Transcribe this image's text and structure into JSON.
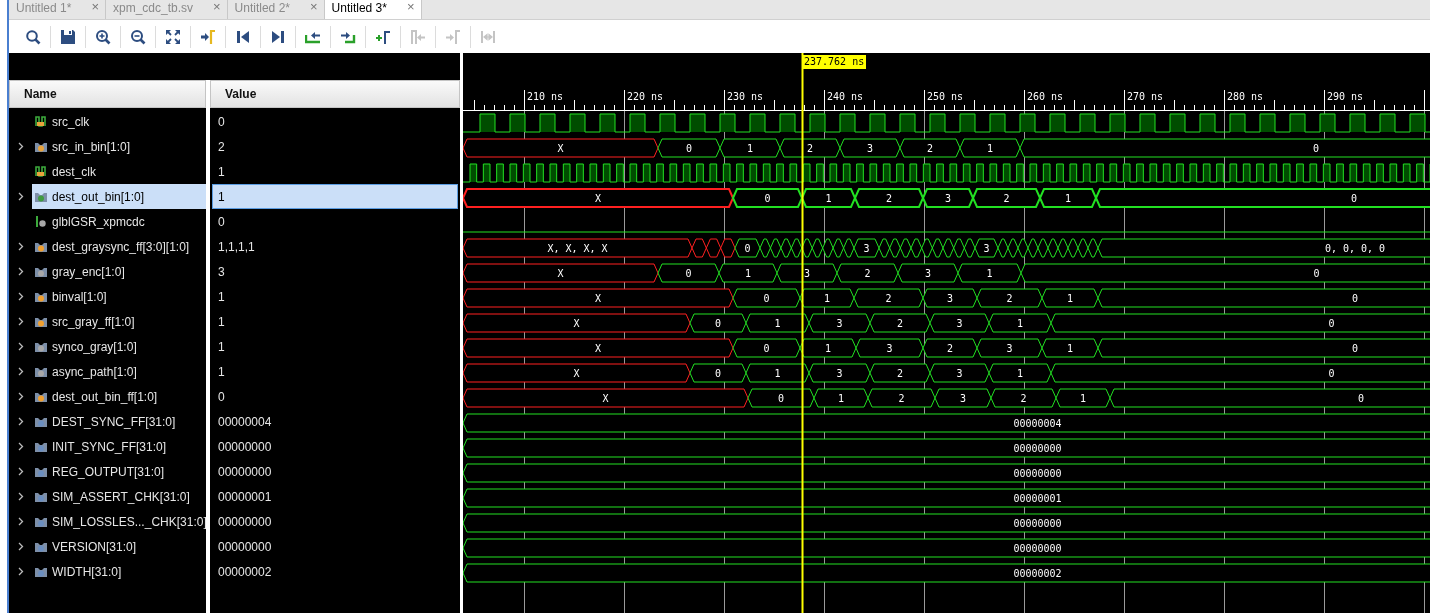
{
  "tabs": [
    {
      "label": "Untitled 1*",
      "close": "×",
      "selected": false
    },
    {
      "label": "xpm_cdc_tb.sv",
      "close": "×",
      "selected": false
    },
    {
      "label": "Untitled 2*",
      "close": "×",
      "selected": false
    },
    {
      "label": "Untitled 3*",
      "close": "×",
      "selected": true
    }
  ],
  "toolbar": [
    {
      "kind": "search",
      "disabled": false
    },
    {
      "kind": "save",
      "disabled": false
    },
    {
      "kind": "zoom_in",
      "disabled": false
    },
    {
      "kind": "zoom_out",
      "disabled": false
    },
    {
      "kind": "zoom_fit",
      "disabled": false
    },
    {
      "kind": "go_to_cursor",
      "disabled": false
    },
    {
      "kind": "go_to_start",
      "disabled": false
    },
    {
      "kind": "go_to_end",
      "disabled": false
    },
    {
      "kind": "previous_transition",
      "disabled": false
    },
    {
      "kind": "next_transition",
      "disabled": false
    },
    {
      "kind": "add_marker",
      "disabled": false
    },
    {
      "kind": "previous_marker",
      "disabled": true
    },
    {
      "kind": "next_marker",
      "disabled": true
    },
    {
      "kind": "swap_markers",
      "disabled": true
    }
  ],
  "columns": [
    "Name",
    "Value"
  ],
  "cursor": {
    "time": "237.762 ns"
  },
  "ruler": [
    "210 ns",
    "220 ns",
    "230 ns",
    "240 ns",
    "250 ns",
    "260 ns",
    "270 ns",
    "280 ns",
    "290 ns"
  ],
  "signals": [
    {
      "name": "src_clk",
      "value": "0",
      "kind": "clock",
      "expandable": false,
      "selected": false,
      "color": "#e8a33c"
    },
    {
      "name": "src_in_bin[1:0]",
      "value": "2",
      "kind": "bus",
      "expandable": true,
      "selected": false,
      "color": "#e8a33c",
      "wave_values": [
        {
          "value": "X",
          "unknown": true
        },
        {
          "value": "0",
          "unknown": false
        },
        {
          "value": "1",
          "unknown": false
        },
        {
          "value": "2",
          "unknown": false
        },
        {
          "value": "3",
          "unknown": false
        },
        {
          "value": "2",
          "unknown": false
        },
        {
          "value": "1",
          "unknown": false
        },
        {
          "value": "0",
          "unknown": false
        }
      ]
    },
    {
      "name": "dest_clk",
      "value": "1",
      "kind": "clock",
      "expandable": false,
      "selected": false,
      "color": "#e8a33c"
    },
    {
      "name": "dest_out_bin[1:0]",
      "value": "1",
      "kind": "bus",
      "expandable": true,
      "selected": true,
      "color": "#3f9b3f",
      "wave_values": [
        {
          "value": "X",
          "unknown": true
        },
        {
          "value": "0",
          "unknown": false
        },
        {
          "value": "1",
          "unknown": false
        },
        {
          "value": "2",
          "unknown": false
        },
        {
          "value": "3",
          "unknown": false
        },
        {
          "value": "2",
          "unknown": false
        },
        {
          "value": "1",
          "unknown": false
        },
        {
          "value": "0",
          "unknown": false
        }
      ]
    },
    {
      "name": "glblGSR_xpmcdc",
      "value": "0",
      "kind": "bit",
      "expandable": false,
      "selected": false,
      "color": "#a8a8a8"
    },
    {
      "name": "dest_graysync_ff[3:0][1:0]",
      "value": "1,1,1,1",
      "kind": "bus",
      "expandable": true,
      "selected": false,
      "color": "#f0a030",
      "wave_values": [
        {
          "value": "X, X, X, X",
          "unknown": true
        },
        {
          "value": "0",
          "unknown": false
        },
        {
          "value": "3",
          "unknown": false
        },
        {
          "value": "3",
          "unknown": false
        },
        {
          "value": "0, 0, 0, 0",
          "unknown": false
        }
      ]
    },
    {
      "name": "gray_enc[1:0]",
      "value": "3",
      "kind": "bus",
      "expandable": true,
      "selected": false,
      "color": "#a8a8a8",
      "wave_values": [
        {
          "value": "X",
          "unknown": true
        },
        {
          "value": "0",
          "unknown": false
        },
        {
          "value": "1",
          "unknown": false
        },
        {
          "value": "3",
          "unknown": false
        },
        {
          "value": "2",
          "unknown": false
        },
        {
          "value": "3",
          "unknown": false
        },
        {
          "value": "1",
          "unknown": false
        },
        {
          "value": "0",
          "unknown": false
        }
      ]
    },
    {
      "name": "binval[1:0]",
      "value": "1",
      "kind": "bus",
      "expandable": true,
      "selected": false,
      "color": "#f0a030",
      "wave_values": [
        {
          "value": "X",
          "unknown": true
        },
        {
          "value": "0",
          "unknown": false
        },
        {
          "value": "1",
          "unknown": false
        },
        {
          "value": "2",
          "unknown": false
        },
        {
          "value": "3",
          "unknown": false
        },
        {
          "value": "2",
          "unknown": false
        },
        {
          "value": "1",
          "unknown": false
        },
        {
          "value": "0",
          "unknown": false
        }
      ]
    },
    {
      "name": "src_gray_ff[1:0]",
      "value": "1",
      "kind": "bus",
      "expandable": true,
      "selected": false,
      "color": "#f0a030",
      "wave_values": [
        {
          "value": "X",
          "unknown": true
        },
        {
          "value": "0",
          "unknown": false
        },
        {
          "value": "1",
          "unknown": false
        },
        {
          "value": "3",
          "unknown": false
        },
        {
          "value": "2",
          "unknown": false
        },
        {
          "value": "3",
          "unknown": false
        },
        {
          "value": "1",
          "unknown": false
        },
        {
          "value": "0",
          "unknown": false
        }
      ]
    },
    {
      "name": "synco_gray[1:0]",
      "value": "1",
      "kind": "bus",
      "expandable": true,
      "selected": false,
      "color": "#a8a8a8",
      "wave_values": [
        {
          "value": "X",
          "unknown": true
        },
        {
          "value": "0",
          "unknown": false
        },
        {
          "value": "1",
          "unknown": false
        },
        {
          "value": "3",
          "unknown": false
        },
        {
          "value": "2",
          "unknown": false
        },
        {
          "value": "3",
          "unknown": false
        },
        {
          "value": "1",
          "unknown": false
        },
        {
          "value": "0",
          "unknown": false
        }
      ]
    },
    {
      "name": "async_path[1:0]",
      "value": "1",
      "kind": "bus",
      "expandable": true,
      "selected": false,
      "color": "#a8a8a8",
      "wave_values": [
        {
          "value": "X",
          "unknown": true
        },
        {
          "value": "0",
          "unknown": false
        },
        {
          "value": "1",
          "unknown": false
        },
        {
          "value": "3",
          "unknown": false
        },
        {
          "value": "2",
          "unknown": false
        },
        {
          "value": "3",
          "unknown": false
        },
        {
          "value": "1",
          "unknown": false
        },
        {
          "value": "0",
          "unknown": false
        }
      ]
    },
    {
      "name": "dest_out_bin_ff[1:0]",
      "value": "0",
      "kind": "bus",
      "expandable": true,
      "selected": false,
      "color": "#f0a030",
      "wave_values": [
        {
          "value": "X",
          "unknown": true
        },
        {
          "value": "0",
          "unknown": false
        },
        {
          "value": "1",
          "unknown": false
        },
        {
          "value": "2",
          "unknown": false
        },
        {
          "value": "3",
          "unknown": false
        },
        {
          "value": "2",
          "unknown": false
        },
        {
          "value": "1",
          "unknown": false
        },
        {
          "value": "0",
          "unknown": false
        }
      ]
    },
    {
      "name": "DEST_SYNC_FF[31:0]",
      "value": "00000004",
      "kind": "param",
      "expandable": true,
      "selected": false,
      "color": "#6b8fc0",
      "wave_values": [
        {
          "value": "00000004",
          "unknown": false
        }
      ]
    },
    {
      "name": "INIT_SYNC_FF[31:0]",
      "value": "00000000",
      "kind": "param",
      "expandable": true,
      "selected": false,
      "color": "#6b8fc0",
      "wave_values": [
        {
          "value": "00000000",
          "unknown": false
        }
      ]
    },
    {
      "name": "REG_OUTPUT[31:0]",
      "value": "00000000",
      "kind": "param",
      "expandable": true,
      "selected": false,
      "color": "#6b8fc0",
      "wave_values": [
        {
          "value": "00000000",
          "unknown": false
        }
      ]
    },
    {
      "name": "SIM_ASSERT_CHK[31:0]",
      "value": "00000001",
      "kind": "param",
      "expandable": true,
      "selected": false,
      "color": "#6b8fc0",
      "wave_values": [
        {
          "value": "00000001",
          "unknown": false
        }
      ]
    },
    {
      "name": "SIM_LOSSLES..._CHK[31:0]",
      "value": "00000000",
      "kind": "param",
      "expandable": true,
      "selected": false,
      "color": "#6b8fc0",
      "wave_values": [
        {
          "value": "00000000",
          "unknown": false
        }
      ]
    },
    {
      "name": "VERSION[31:0]",
      "value": "00000000",
      "kind": "param",
      "expandable": true,
      "selected": false,
      "color": "#6b8fc0",
      "wave_values": [
        {
          "value": "00000000",
          "unknown": false
        }
      ]
    },
    {
      "name": "WIDTH[31:0]",
      "value": "00000002",
      "kind": "param",
      "expandable": true,
      "selected": false,
      "color": "#6b8fc0",
      "wave_values": [
        {
          "value": "00000002",
          "unknown": false
        }
      ]
    }
  ]
}
